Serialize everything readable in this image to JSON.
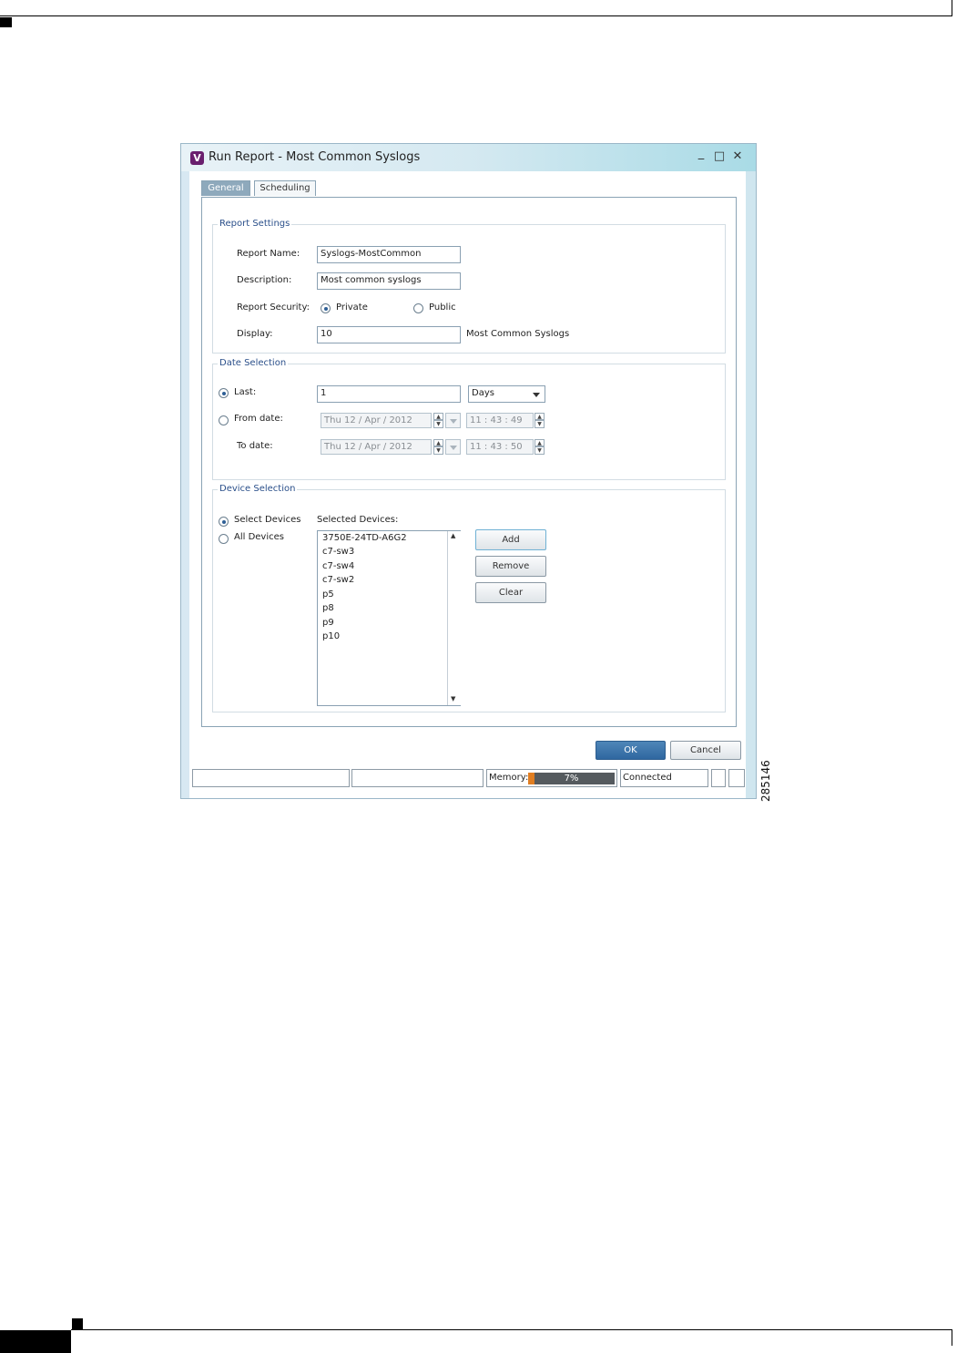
{
  "window": {
    "title": "Run Report - Most Common Syslogs",
    "app_icon_letter": "V",
    "minimize_glyph": "_",
    "maximize_glyph": "□",
    "close_glyph": "✕"
  },
  "tabs": [
    {
      "label": "General",
      "active": true
    },
    {
      "label": "Scheduling",
      "active": false
    }
  ],
  "report_settings": {
    "legend": "Report Settings",
    "report_name_label": "Report Name:",
    "report_name_value": "Syslogs-MostCommon",
    "description_label": "Description:",
    "description_value": "Most common syslogs",
    "security_label": "Report Security:",
    "security_options": [
      {
        "label": "Private",
        "selected": true
      },
      {
        "label": "Public",
        "selected": false
      }
    ],
    "display_label": "Display:",
    "display_value": "10",
    "display_suffix": "Most Common Syslogs"
  },
  "date_selection": {
    "legend": "Date Selection",
    "last_label": "Last:",
    "last_selected": true,
    "last_value": "1",
    "last_unit": "Days",
    "from_label": "From date:",
    "from_date": "Thu 12  /  Apr  /  2012",
    "from_time": "11  :  43  :  49",
    "to_label": "To date:",
    "to_date": "Thu 12  /  Apr  /  2012",
    "to_time": "11  :  43  :  50"
  },
  "device_selection": {
    "legend": "Device Selection",
    "select_devices_label": "Select Devices",
    "select_devices_selected": true,
    "all_devices_label": "All Devices",
    "selected_devices_label": "Selected Devices:",
    "devices": [
      "3750E-24TD-A6G2",
      "c7-sw3",
      "c7-sw4",
      "c7-sw2",
      "p5",
      "p8",
      "p9",
      "p10"
    ],
    "add_label": "Add",
    "remove_label": "Remove",
    "clear_label": "Clear"
  },
  "footer": {
    "ok_label": "OK",
    "cancel_label": "Cancel"
  },
  "status_bar": {
    "memory_label": "Memory:",
    "memory_percent": "7%",
    "memory_fraction": 0.07,
    "connection_status": "Connected"
  },
  "figure_number": "285146",
  "colors": {
    "accent": "#2e5f96",
    "memory_fill": "#e07d21",
    "title_gradient_end": "#a9dbe6"
  }
}
